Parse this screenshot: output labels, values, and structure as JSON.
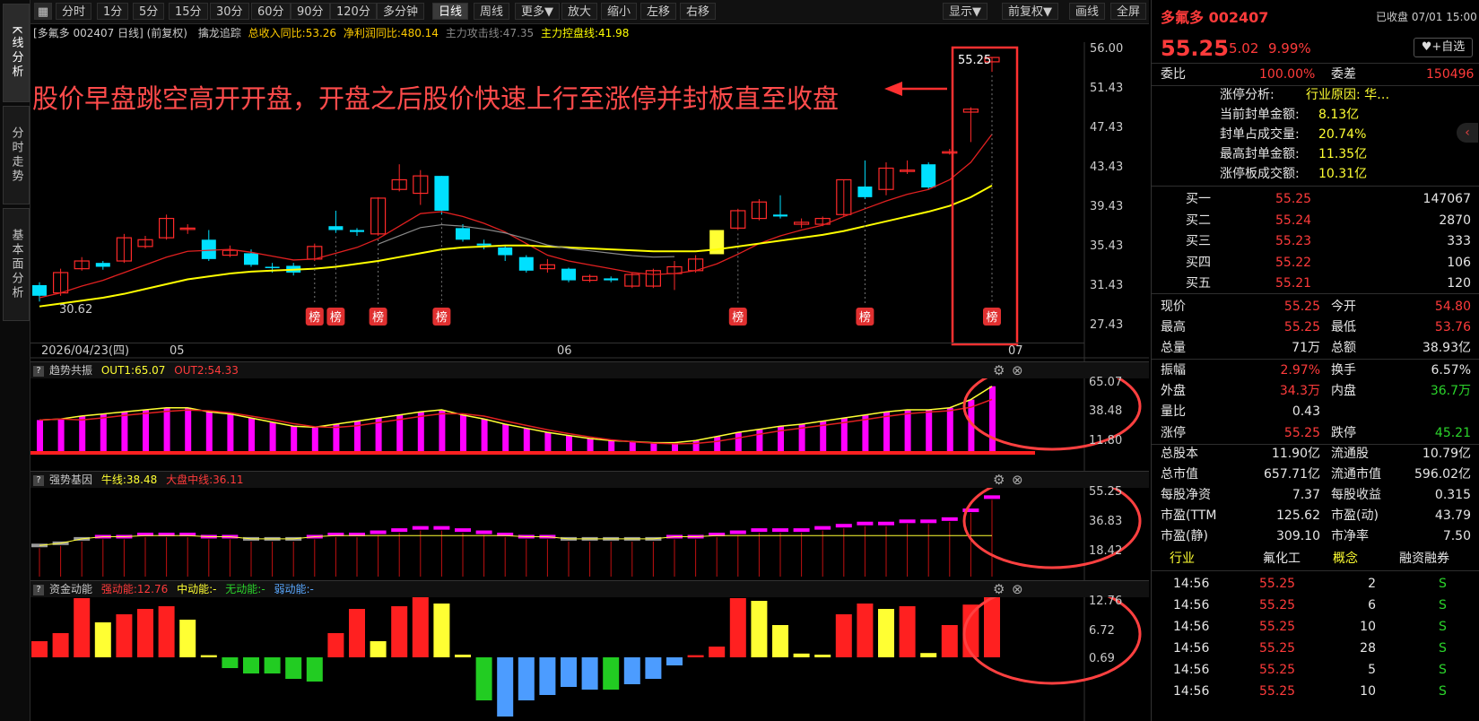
{
  "left_tabs": [
    {
      "label": "K线分析"
    },
    {
      "label": "分时走势"
    },
    {
      "label": "基本面分析"
    }
  ],
  "toolbar": {
    "periods": [
      "分时",
      "1分",
      "5分",
      "15分",
      "30分",
      "60分",
      "90分",
      "120分",
      "多分钟",
      "日线",
      "周线",
      "更多▼",
      "放大",
      "缩小",
      "左移",
      "右移"
    ],
    "active": "日线",
    "right": [
      "显示▼",
      "前复权▼",
      "画线",
      "全屏"
    ]
  },
  "chart_header": {
    "stock": "[多氟多 002407 日线] (前复权)",
    "indicator": "擒龙追踪",
    "fields": [
      {
        "label": "总收入同比:53.26",
        "color": "#ffcc00"
      },
      {
        "label": "净利润同比:480.14",
        "color": "#ffcc00"
      },
      {
        "label": "主力攻击线:47.35",
        "color": "#888888"
      },
      {
        "label": "主力控盘线:41.98",
        "color": "#ffff00"
      }
    ]
  },
  "annotation": "股价早盘跳空高开开盘，开盘之后股价快速上行至涨停并封板直至收盘",
  "price_axis": [
    "56.00",
    "51.43",
    "47.43",
    "43.43",
    "39.43",
    "35.43",
    "31.43",
    "27.43"
  ],
  "price_marker": "55.25",
  "low_marker": "30.62",
  "bang_label": "榜",
  "date_axis": {
    "start": "2026/04/23(四)",
    "m1": "05",
    "m2": "06",
    "m3": "07"
  },
  "pane_trend": {
    "title": "趋势共振",
    "out1": "OUT1:65.07",
    "out2": "OUT2:54.33",
    "axis": [
      "65.07",
      "38.48",
      "11.80"
    ]
  },
  "pane_strong": {
    "title": "强势基因",
    "niu": "牛线:38.48",
    "dapan": "大盘中线:36.11",
    "axis": [
      "55.25",
      "36.83",
      "18.42"
    ]
  },
  "pane_money": {
    "title": "资金动能",
    "strong": "强动能:12.76",
    "mid": "中动能:-",
    "none": "无动能:-",
    "weak": "弱动能:-",
    "axis": [
      "12.76",
      "6.72",
      "0.69"
    ]
  },
  "chart_data": {
    "type": "candlestick",
    "candles": [
      [
        31.7,
        30.6,
        32.0,
        30.0
      ],
      [
        30.9,
        33.0,
        33.4,
        30.6
      ],
      [
        33.4,
        34.2,
        34.6,
        33.2
      ],
      [
        34.0,
        33.6,
        34.2,
        33.3
      ],
      [
        34.2,
        36.6,
        37.0,
        34.0
      ],
      [
        35.7,
        36.4,
        36.8,
        35.5
      ],
      [
        36.6,
        38.6,
        39.0,
        36.4
      ],
      [
        37.6,
        37.6,
        38.0,
        37.0
      ],
      [
        36.4,
        34.4,
        37.4,
        34.2
      ],
      [
        34.8,
        35.3,
        35.8,
        34.6
      ],
      [
        35.0,
        33.8,
        35.4,
        33.6
      ],
      [
        33.6,
        33.5,
        34.0,
        33.0
      ],
      [
        33.7,
        33.0,
        34.0,
        32.7
      ],
      [
        34.4,
        35.7,
        36.0,
        34.2
      ],
      [
        37.8,
        37.4,
        39.4,
        37.1
      ],
      [
        37.4,
        37.2,
        37.6,
        36.8
      ],
      [
        37.0,
        40.7,
        40.8,
        36.8
      ],
      [
        41.6,
        42.6,
        44.2,
        41.4
      ],
      [
        41.2,
        43.0,
        43.6,
        40.0
      ],
      [
        43.0,
        39.4,
        43.0,
        39.0
      ],
      [
        37.6,
        36.4,
        38.0,
        36.2
      ],
      [
        36.0,
        35.8,
        36.4,
        35.4
      ],
      [
        35.6,
        34.8,
        35.8,
        34.2
      ],
      [
        34.6,
        33.2,
        34.8,
        33.0
      ],
      [
        33.4,
        33.8,
        34.4,
        33.0
      ],
      [
        33.4,
        32.2,
        33.5,
        32.0
      ],
      [
        32.2,
        32.6,
        32.8,
        32.0
      ],
      [
        32.4,
        32.2,
        32.6,
        32.0
      ],
      [
        31.6,
        32.8,
        33.0,
        31.4
      ],
      [
        31.6,
        33.2,
        33.4,
        31.4
      ],
      [
        32.9,
        33.6,
        34.2,
        31.2
      ],
      [
        33.2,
        34.4,
        34.8,
        33.0
      ],
      [
        34.9,
        37.4,
        37.4,
        34.9
      ],
      [
        37.6,
        39.4,
        39.6,
        37.4
      ],
      [
        38.6,
        40.3,
        40.6,
        38.4
      ],
      [
        39.0,
        38.8,
        41.0,
        38.6
      ],
      [
        38.0,
        38.2,
        38.6,
        37.6
      ],
      [
        38.0,
        38.6,
        38.8,
        37.8
      ],
      [
        39.0,
        42.6,
        42.6,
        38.8
      ],
      [
        41.9,
        40.8,
        44.6,
        40.6
      ],
      [
        41.6,
        43.8,
        44.4,
        41.0
      ],
      [
        43.6,
        43.6,
        44.6,
        43.2
      ],
      [
        44.2,
        41.8,
        44.4,
        41.6
      ],
      [
        45.4,
        45.5,
        45.8,
        45.2
      ],
      [
        49.6,
        49.9,
        50.1,
        46.5
      ],
      [
        54.8,
        55.25,
        55.25,
        53.76
      ]
    ],
    "ma_fast": [
      30.4,
      30.9,
      31.6,
      32.2,
      33.0,
      33.8,
      34.6,
      35.2,
      35.3,
      35.4,
      35.1,
      34.7,
      34.3,
      34.4,
      35.0,
      35.6,
      36.5,
      37.8,
      39.1,
      39.3,
      38.8,
      38.1,
      37.2,
      36.0,
      34.8,
      34.2,
      33.8,
      33.4,
      33.0,
      32.8,
      32.9,
      33.2,
      33.9,
      34.9,
      36.0,
      36.8,
      37.4,
      37.9,
      38.8,
      39.6,
      40.4,
      41.1,
      41.6,
      42.6,
      44.4,
      47.3
    ],
    "ma_slow": [
      29.5,
      29.8,
      30.1,
      30.4,
      30.8,
      31.3,
      31.8,
      32.3,
      32.6,
      32.9,
      33.1,
      33.2,
      33.3,
      33.4,
      33.6,
      33.9,
      34.2,
      34.6,
      35.0,
      35.4,
      35.6,
      35.7,
      35.8,
      35.8,
      35.7,
      35.6,
      35.5,
      35.4,
      35.3,
      35.2,
      35.2,
      35.2,
      35.4,
      35.7,
      36.0,
      36.3,
      36.6,
      36.9,
      37.3,
      37.8,
      38.3,
      38.8,
      39.3,
      39.9,
      40.8,
      42.0
    ],
    "trend_bars": [
      32,
      33,
      36,
      38,
      40,
      42,
      44,
      44,
      40,
      38,
      34,
      30,
      26,
      25,
      28,
      31,
      34,
      37,
      40,
      42,
      37,
      33,
      28,
      24,
      20,
      17,
      14,
      12,
      11,
      10,
      10,
      12,
      16,
      20,
      23,
      26,
      28,
      31,
      34,
      37,
      40,
      42,
      42,
      44,
      52,
      65
    ],
    "strong_bars": [
      33,
      34,
      36,
      37,
      37,
      38,
      38,
      38,
      37,
      37,
      36,
      36,
      36,
      37,
      38,
      38,
      39,
      40,
      41,
      41,
      40,
      39,
      38,
      37,
      37,
      36,
      36,
      36,
      36,
      36,
      37,
      37,
      38,
      39,
      40,
      40,
      40,
      41,
      42,
      43,
      43,
      44,
      44,
      45,
      49,
      55
    ],
    "money_bars": [
      [
        3,
        "r"
      ],
      [
        4.5,
        "r"
      ],
      [
        11,
        "r"
      ],
      [
        6.5,
        "y"
      ],
      [
        8,
        "r"
      ],
      [
        9,
        "r"
      ],
      [
        9.5,
        "r"
      ],
      [
        7,
        "y"
      ],
      [
        0.4,
        "y"
      ],
      [
        -2,
        "g"
      ],
      [
        -3,
        "g"
      ],
      [
        -3,
        "g"
      ],
      [
        -4,
        "g"
      ],
      [
        -4.5,
        "g"
      ],
      [
        4.5,
        "r"
      ],
      [
        9,
        "r"
      ],
      [
        3,
        "y"
      ],
      [
        9.5,
        "r"
      ],
      [
        13,
        "r"
      ],
      [
        10,
        "y"
      ],
      [
        0.5,
        "y"
      ],
      [
        -8,
        "g"
      ],
      [
        -11,
        "b"
      ],
      [
        -8,
        "b"
      ],
      [
        -7,
        "b"
      ],
      [
        -5.5,
        "b"
      ],
      [
        -6,
        "b"
      ],
      [
        -6,
        "g"
      ],
      [
        -5,
        "b"
      ],
      [
        -4,
        "b"
      ],
      [
        -1.5,
        "b"
      ],
      [
        0.4,
        "r"
      ],
      [
        2,
        "r"
      ],
      [
        11,
        "r"
      ],
      [
        10.5,
        "y"
      ],
      [
        6,
        "y"
      ],
      [
        0.7,
        "y"
      ],
      [
        0.5,
        "y"
      ],
      [
        8,
        "r"
      ],
      [
        10,
        "r"
      ],
      [
        9,
        "y"
      ],
      [
        9.5,
        "r"
      ],
      [
        0.8,
        "y"
      ],
      [
        6,
        "r"
      ],
      [
        9.8,
        "r"
      ],
      [
        12.76,
        "r"
      ]
    ],
    "bang_positions": [
      13,
      14,
      16,
      19,
      33,
      39,
      45
    ]
  },
  "quote": {
    "name": "多氟多 002407",
    "status": "已收盘 07/01 15:00",
    "price": "55.25",
    "change": "5.02",
    "pct": "9.99%",
    "watch": "+自选",
    "weibi_label": "委比",
    "weibi": "100.00%",
    "weicha_label": "委差",
    "weicha": "150496",
    "zt_rows": [
      {
        "label": "涨停分析:",
        "value": "行业原因: 华…"
      },
      {
        "label": "当前封单金额:",
        "value": "8.13亿"
      },
      {
        "label": "封单占成交量:",
        "value": "20.74%"
      },
      {
        "label": "最高封单金额:",
        "value": "11.35亿"
      },
      {
        "label": "涨停板成交额:",
        "value": "10.31亿"
      }
    ],
    "bids": [
      {
        "label": "买一",
        "price": "55.25",
        "vol": "147067"
      },
      {
        "label": "买二",
        "price": "55.24",
        "vol": "2870"
      },
      {
        "label": "买三",
        "price": "55.23",
        "vol": "333"
      },
      {
        "label": "买四",
        "price": "55.22",
        "vol": "106"
      },
      {
        "label": "买五",
        "price": "55.21",
        "vol": "120"
      }
    ],
    "stats": [
      {
        "l1": "现价",
        "v1": "55.25",
        "c1": "red",
        "l2": "今开",
        "v2": "54.80",
        "c2": "red"
      },
      {
        "l1": "最高",
        "v1": "55.25",
        "c1": "red",
        "l2": "最低",
        "v2": "53.76",
        "c2": "red"
      },
      {
        "l1": "总量",
        "v1": "71万",
        "c1": "wht",
        "l2": "总额",
        "v2": "38.93亿",
        "c2": "wht"
      },
      {
        "l1": "振幅",
        "v1": "2.97%",
        "c1": "red",
        "l2": "换手",
        "v2": "6.57%",
        "c2": "wht"
      },
      {
        "l1": "外盘",
        "v1": "34.3万",
        "c1": "red",
        "l2": "内盘",
        "v2": "36.7万",
        "c2": "grn"
      },
      {
        "l1": "量比",
        "v1": "0.43",
        "c1": "wht",
        "l2": "",
        "v2": "",
        "c2": "wht"
      },
      {
        "l1": "涨停",
        "v1": "55.25",
        "c1": "red",
        "l2": "跌停",
        "v2": "45.21",
        "c2": "grn"
      },
      {
        "l1": "总股本",
        "v1": "11.90亿",
        "c1": "wht",
        "l2": "流通股",
        "v2": "10.79亿",
        "c2": "wht"
      },
      {
        "l1": "总市值",
        "v1": "657.71亿",
        "c1": "wht",
        "l2": "流通市值",
        "v2": "596.02亿",
        "c2": "wht"
      },
      {
        "l1": "每股净资",
        "v1": "7.37",
        "c1": "wht",
        "l2": "每股收益",
        "v2": "0.315",
        "c2": "wht"
      },
      {
        "l1": "市盈(TTM",
        "v1": "125.62",
        "c1": "wht",
        "l2": "市盈(动)",
        "v2": "43.79",
        "c2": "wht"
      },
      {
        "l1": "市盈(静)",
        "v1": "309.10",
        "c1": "wht",
        "l2": "市净率",
        "v2": "7.50",
        "c2": "wht"
      }
    ],
    "tags": {
      "hy": "行业",
      "hyv": "氟化工",
      "gn": "概念",
      "rz": "融资融券"
    },
    "trades": [
      {
        "t": "14:56",
        "p": "55.25",
        "v": "2",
        "d": "S"
      },
      {
        "t": "14:56",
        "p": "55.25",
        "v": "6",
        "d": "S"
      },
      {
        "t": "14:56",
        "p": "55.25",
        "v": "10",
        "d": "S"
      },
      {
        "t": "14:56",
        "p": "55.25",
        "v": "28",
        "d": "S"
      },
      {
        "t": "14:56",
        "p": "55.25",
        "v": "5",
        "d": "S"
      },
      {
        "t": "14:56",
        "p": "55.25",
        "v": "10",
        "d": "S"
      }
    ]
  },
  "colors": {
    "up": "#ff2a2a",
    "down": "#00e0ff",
    "ma_fast": "#e02020",
    "ma_slow": "#ffff00",
    "magenta": "#ff00ff",
    "accent": "#ff3b3b"
  }
}
